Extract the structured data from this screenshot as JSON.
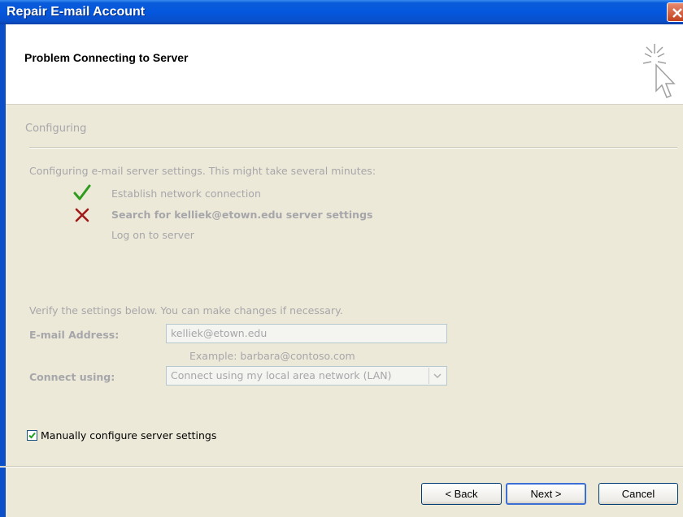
{
  "window": {
    "title": "Repair E-mail Account"
  },
  "header": {
    "title": "Problem Connecting to Server"
  },
  "section": {
    "title": "Configuring"
  },
  "progress": {
    "intro": "Configuring e-mail server settings. This might take several minutes:",
    "steps": [
      {
        "label": "Establish network connection",
        "status": "done",
        "icon": "checkmark-icon",
        "color": "#2E9B1E"
      },
      {
        "label": "Search for kelliek@etown.edu server settings",
        "status": "failed",
        "icon": "x-icon",
        "color": "#A01818"
      },
      {
        "label": "Log on to server",
        "status": "pending"
      }
    ]
  },
  "settings": {
    "intro": "Verify the settings below. You can make changes if necessary.",
    "email_label": "E-mail Address:",
    "email_value": "kelliek@etown.edu",
    "email_example": "Example: barbara@contoso.com",
    "connect_label": "Connect using:",
    "connect_value": "Connect using my local area network (LAN)"
  },
  "manual": {
    "label": "Manually configure server settings",
    "checked": true
  },
  "buttons": {
    "back": "< Back",
    "next": "Next >",
    "cancel": "Cancel"
  }
}
